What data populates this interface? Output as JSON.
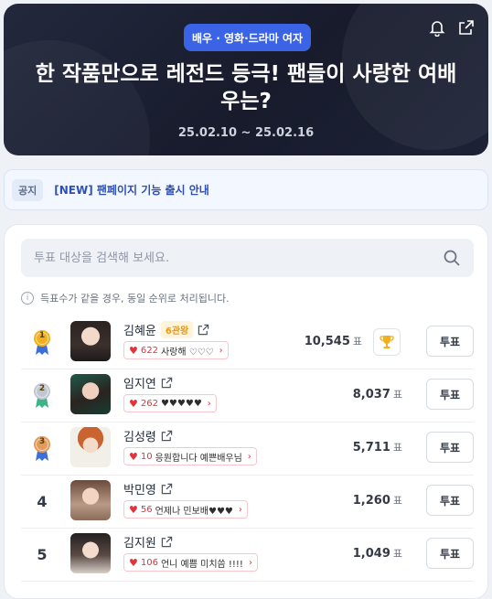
{
  "hero": {
    "badge": "배우 · 영화·드라마 여자",
    "title": "한 작품만으로 레전드 등극! 팬들이 사랑한 여배우는?",
    "dates": "25.02.10 ~ 25.02.16",
    "icons": [
      "bell-icon",
      "share-icon"
    ]
  },
  "notice": {
    "tag": "공지",
    "text": "[NEW] 팬페이지 기능 출시 안내"
  },
  "search": {
    "placeholder": "투표 대상을 검색해 보세요."
  },
  "info": "득표수가 같을 경우, 동일 순위로 처리됩니다.",
  "vote_unit": "표",
  "vote_button": "투표",
  "rows": [
    {
      "rank": "1",
      "name": "김혜윤",
      "crown": "6관왕",
      "count": "622",
      "message": "사랑해 ♡♡♡",
      "votes": "10,545",
      "medal_color": "#f2b01e"
    },
    {
      "rank": "2",
      "name": "임지연",
      "crown": "",
      "count": "262",
      "message": "♥♥♥♥♥",
      "votes": "8,037",
      "medal_color": "#c0c7d2"
    },
    {
      "rank": "3",
      "name": "김성령",
      "crown": "",
      "count": "10",
      "message": "응원합니다 예쁜배우님",
      "votes": "5,711",
      "medal_color": "#e49a5a"
    },
    {
      "rank": "4",
      "name": "박민영",
      "crown": "",
      "count": "56",
      "message": "언제나 민보배♥♥♥",
      "votes": "1,260",
      "medal_color": ""
    },
    {
      "rank": "5",
      "name": "김지원",
      "crown": "",
      "count": "106",
      "message": "언니 예쁨 미치씀 !!!!",
      "votes": "1,049",
      "medal_color": ""
    }
  ],
  "colors": {
    "accent": "#3a63e6",
    "heart": "#e0343a",
    "hero_bg": "#1b1f31"
  }
}
